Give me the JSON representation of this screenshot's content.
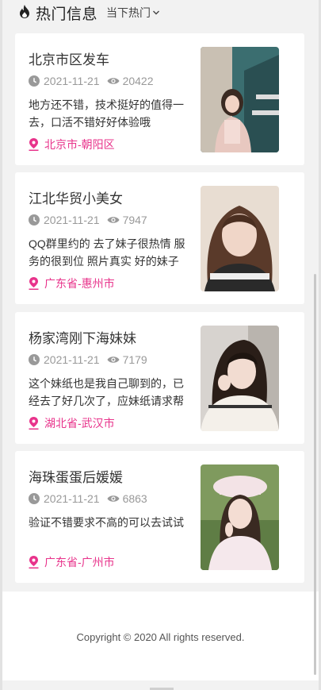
{
  "header": {
    "title": "热门信息",
    "sort_label": "当下热门",
    "fire_icon": "fire-icon",
    "sort_icon": "chevron-down-icon"
  },
  "colors": {
    "location": "#e8338b",
    "meta": "#999999",
    "card_bg": "#ffffff",
    "page_bg": "#f2f2f2"
  },
  "posts": [
    {
      "title": "北京市区发车",
      "date": "2021-11-21",
      "views": "20422",
      "desc": "地方还不错，技术挺好的值得一去，口活不错好好体验哦",
      "location": "北京市-朝阳区"
    },
    {
      "title": "江北华贸小美女",
      "date": "2021-11-21",
      "views": "7947",
      "desc": "QQ群里约的 去了妹子很热情 服务的很到位 照片真实 好的妹子和",
      "location": "广东省-惠州市"
    },
    {
      "title": "杨家湾刚下海妹妹",
      "date": "2021-11-21",
      "views": "7179",
      "desc": "这个妹纸也是我自己聊到的，已经去了好几次了，应妹纸请求帮",
      "location": "湖北省-武汉市"
    },
    {
      "title": "海珠蛋蛋后媛媛",
      "date": "2021-11-21",
      "views": "6863",
      "desc": "验证不错要求不高的可以去试试",
      "location": "广东省-广州市"
    }
  ],
  "footer": {
    "copyright": "Copyright © 2020 All rights reserved."
  }
}
